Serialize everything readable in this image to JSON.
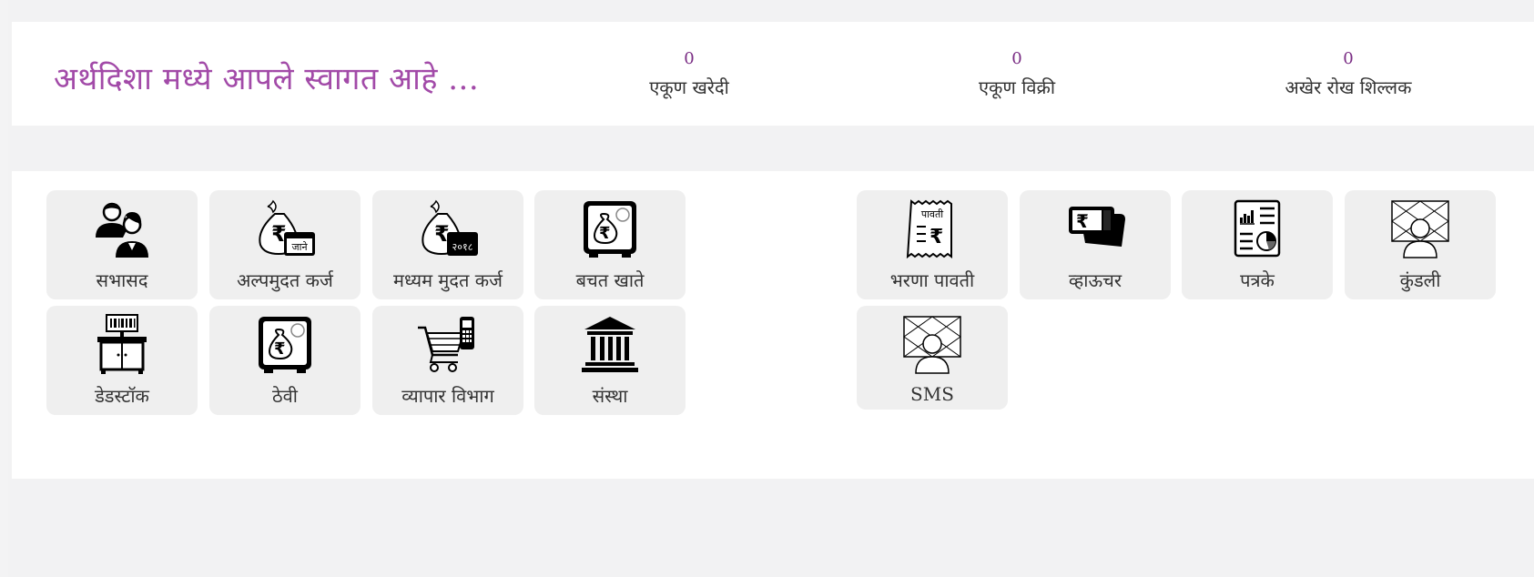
{
  "header": {
    "welcome": "अर्थदिशा मध्ये आपले स्वागत आहे ...",
    "stats": [
      {
        "value": "0",
        "label": "एकूण खरेदी"
      },
      {
        "value": "0",
        "label": "एकूण विक्री"
      },
      {
        "value": "0",
        "label": "अखेर रोख शिल्लक"
      }
    ]
  },
  "tiles": {
    "sabhasad": {
      "label": "सभासद",
      "icon": "members-icon"
    },
    "alpmudat": {
      "label": "अल्पमुदत कर्ज",
      "icon": "money-bag-calendar-icon",
      "badge": "जाने"
    },
    "madhyam": {
      "label": "मध्यम मुदत कर्ज",
      "icon": "money-bag-calendar-icon",
      "badge": "२०१८"
    },
    "bachat": {
      "label": "बचत खाते",
      "icon": "safe-icon"
    },
    "deadstock": {
      "label": "डेडस्टॉक",
      "icon": "cabinet-barcode-icon"
    },
    "thevi": {
      "label": "ठेवी",
      "icon": "safe-icon"
    },
    "vyapar": {
      "label": "व्यापार विभाग",
      "icon": "cart-pos-icon"
    },
    "sanstha": {
      "label": "संस्था",
      "icon": "bank-icon"
    },
    "bharna": {
      "label": "भरणा पावती",
      "icon": "receipt-icon",
      "receipt_text": "पावती"
    },
    "voucher": {
      "label": "व्हाऊचर",
      "icon": "cash-icon"
    },
    "patrake": {
      "label": "पत्रके",
      "icon": "report-icon"
    },
    "kundali": {
      "label": "कुंडली",
      "icon": "profile-grid-icon"
    },
    "sms": {
      "label": "SMS",
      "icon": "profile-grid-icon"
    }
  },
  "colors": {
    "accent": "#a24aa8",
    "stat_value": "#7a2d84",
    "tile_bg": "#efefef"
  }
}
